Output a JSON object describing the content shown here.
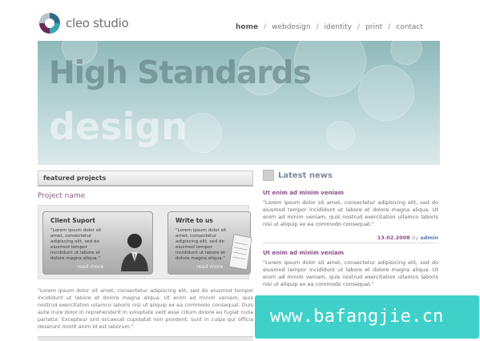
{
  "brand": {
    "name": "cleo studio"
  },
  "nav": {
    "items": [
      "home",
      "webdesign",
      "identity",
      "print",
      "contact"
    ],
    "separator": "/"
  },
  "banner": {
    "line1": "High Standards",
    "line2": "design"
  },
  "featured": {
    "heading": "featured projects",
    "project_name": "Project name",
    "cards": [
      {
        "title": "Client Suport",
        "text": "\"Lorem ipsum dolor sit amet, consectetur adipiscing elit, sed do eiusmod tempor incididunt ut labore et dolore magna aliqua.\"",
        "more": "read more"
      },
      {
        "title": "Write to us",
        "text": "\"Lorem ipsum dolor sit amet, consectetur adipiscing elit, sed do eiusmod tempor incididunt ut labore et dolore magna aliqua.\"",
        "more": "read more"
      }
    ],
    "body": "\"Lorem ipsum dolor sit amet, consectetur adipiscing elit, sed do eiusmod tempor incididunt ut labore et dolore magna aliqua. Ut enim ad minim veniam, quis nostrud exercitation ullamco laboris nisi ut aliquip ex ea commodo consequat. Duis aute irure dolor in reprehenderit in voluptate velit esse cillum dolore eu fugiat nulla pariatur. Excepteur sint occaecat cupidatat non proident, sunt in culpa qui officia deserunt mollit anim id est laborum.\""
  },
  "news": {
    "heading": "Latest news",
    "items": [
      {
        "title": "Ut enim ad minim veniam",
        "text": "\"Lorem ipsum dolor sit amet, consectetur adipisicing elit, sed do eiusmod tempor incididunt ut labore et dolore magna aliqua. Ut enim ad minim veniam, quis nostrud exercitation ullamco laboris nisi ut aliquip ex ea commodo consequat.\"",
        "date": "13.02.2008",
        "by": "by",
        "author": "admin"
      },
      {
        "title": "Ut enim ad minim veniam",
        "text": "\"Lorem ipsum dolor sit amet, consectetur adipisicing elit, sed do eiusmod tempor incididunt ut labore et dolore magna aliqua. Ut enim ad minim veniam, quis nostrud exercitation ullamco laboris nisi ut aliquip ex ea commodo consequat.\""
      }
    ]
  },
  "watermark": {
    "text": "www.bafangjie.cn"
  },
  "colors": {
    "accent": "#8a4f88",
    "banner": "#a9cbcc",
    "watermark": "#3fd1c9"
  }
}
